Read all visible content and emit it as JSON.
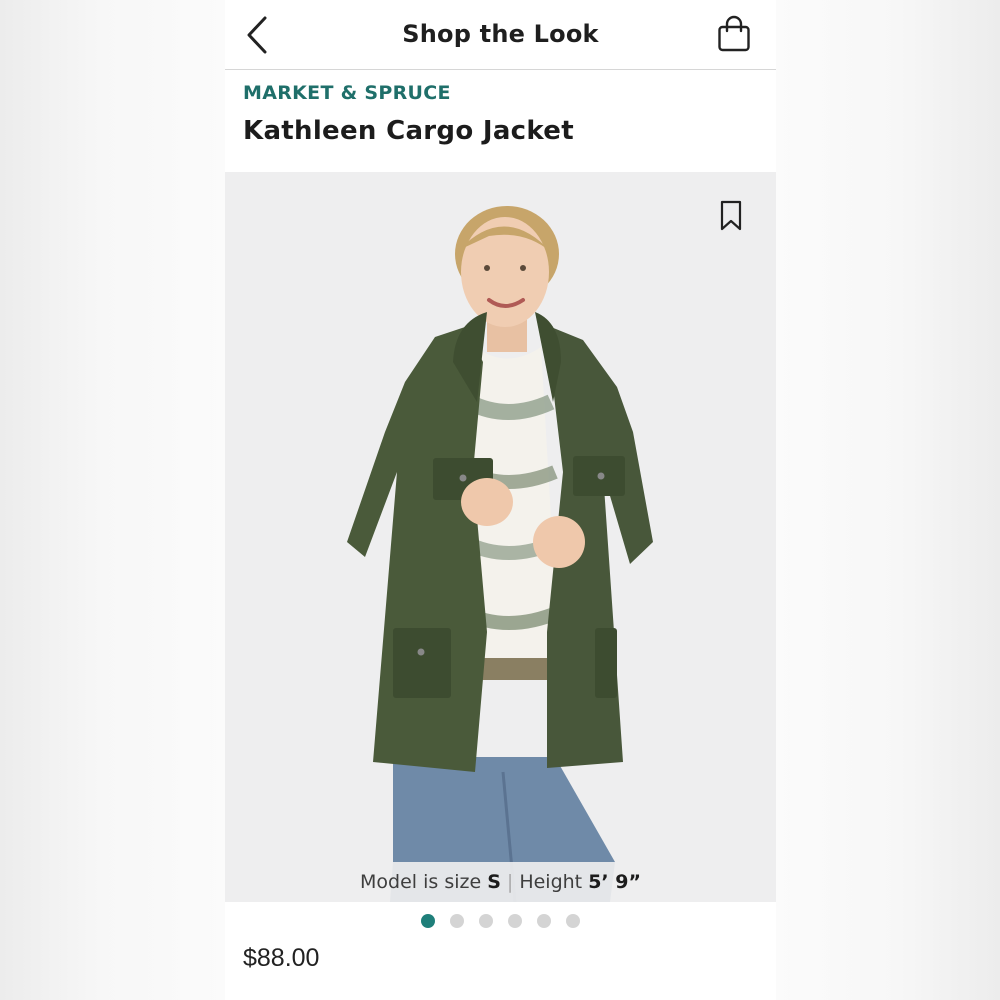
{
  "header": {
    "title": "Shop the Look"
  },
  "product": {
    "brand": "MARKET & SPRUCE",
    "name": "Kathleen Cargo Jacket",
    "price": "$88.00",
    "model_caption": {
      "size_label": "Model is size",
      "size_value": "S",
      "height_label": "Height",
      "height_value": "5’ 9”"
    }
  },
  "carousel": {
    "total_images": 6,
    "active_index": 0
  },
  "icons": {
    "back": "chevron-left-icon",
    "bag": "shopping-bag-icon",
    "bookmark": "bookmark-icon"
  },
  "colors": {
    "accent": "#1f7f7a",
    "brand_text": "#1f6f6a",
    "jacket": "#4a5a3a",
    "jeans": "#6f8aa8"
  }
}
